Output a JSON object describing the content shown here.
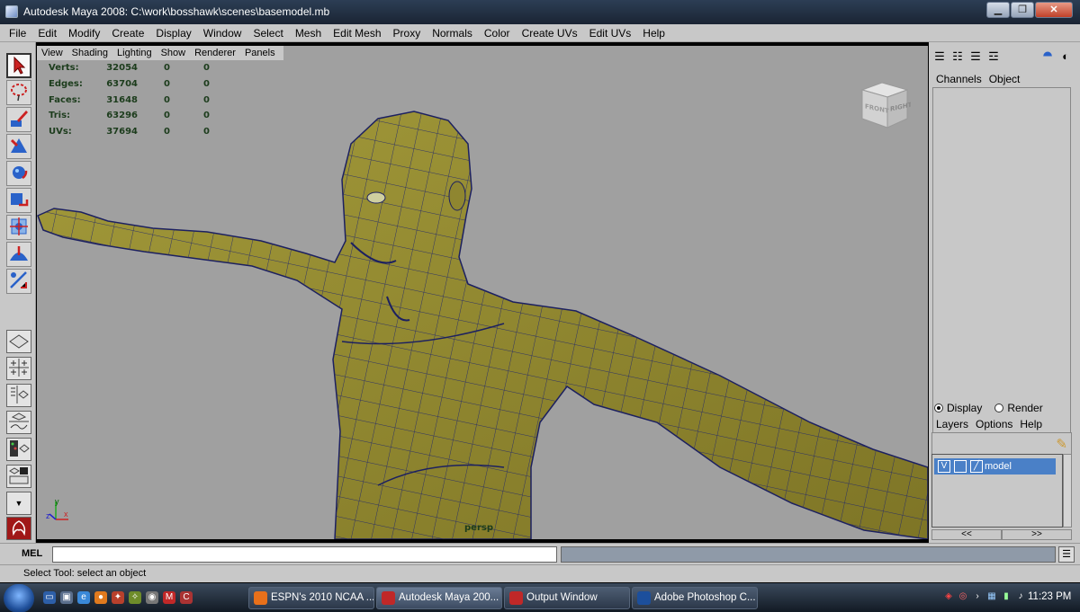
{
  "window": {
    "title": "Autodesk Maya 2008: C:\\work\\bosshawk\\scenes\\basemodel.mb",
    "minimize": "▁",
    "maximize": "❐",
    "close": "✕"
  },
  "menubar": [
    "File",
    "Edit",
    "Modify",
    "Create",
    "Display",
    "Window",
    "Select",
    "Mesh",
    "Edit Mesh",
    "Proxy",
    "Normals",
    "Color",
    "Create UVs",
    "Edit UVs",
    "Help"
  ],
  "panel_menu": [
    "View",
    "Shading",
    "Lighting",
    "Show",
    "Renderer",
    "Panels"
  ],
  "hud": {
    "rows": [
      {
        "label": "Verts:",
        "value": "32054",
        "a": "0",
        "b": "0"
      },
      {
        "label": "Edges:",
        "value": "63704",
        "a": "0",
        "b": "0"
      },
      {
        "label": "Faces:",
        "value": "31648",
        "a": "0",
        "b": "0"
      },
      {
        "label": "Tris:",
        "value": "63296",
        "a": "0",
        "b": "0"
      },
      {
        "label": "UVs:",
        "value": "37694",
        "a": "0",
        "b": "0"
      }
    ]
  },
  "viewport": {
    "camera": "persp",
    "viewcube_front": "FRONT",
    "viewcube_right": "RIGHT",
    "axis_x": "x",
    "axis_y": "y",
    "axis_z": "z"
  },
  "channel_box": {
    "tabs": [
      "Channels",
      "Object"
    ]
  },
  "layer_editor": {
    "display_label": "Display",
    "render_label": "Render",
    "menu": [
      "Layers",
      "Options",
      "Help"
    ],
    "layer": {
      "visible": "V",
      "name": "model"
    },
    "scroll_left": "<<",
    "scroll_right": ">>"
  },
  "command_line": {
    "label": "MEL",
    "value": ""
  },
  "help_line": "Select Tool: select an object",
  "taskbar": {
    "tasks": [
      {
        "label": "ESPN's 2010 NCAA ...",
        "icon": "firefox-icon",
        "color": "#e8701a"
      },
      {
        "label": "Autodesk Maya 200...",
        "icon": "maya-icon",
        "color": "#c02828"
      },
      {
        "label": "Output Window",
        "icon": "maya-icon",
        "color": "#c02828"
      },
      {
        "label": "Adobe Photoshop C...",
        "icon": "photoshop-icon",
        "color": "#1c4f9c"
      }
    ],
    "clock": "11:23 PM"
  }
}
